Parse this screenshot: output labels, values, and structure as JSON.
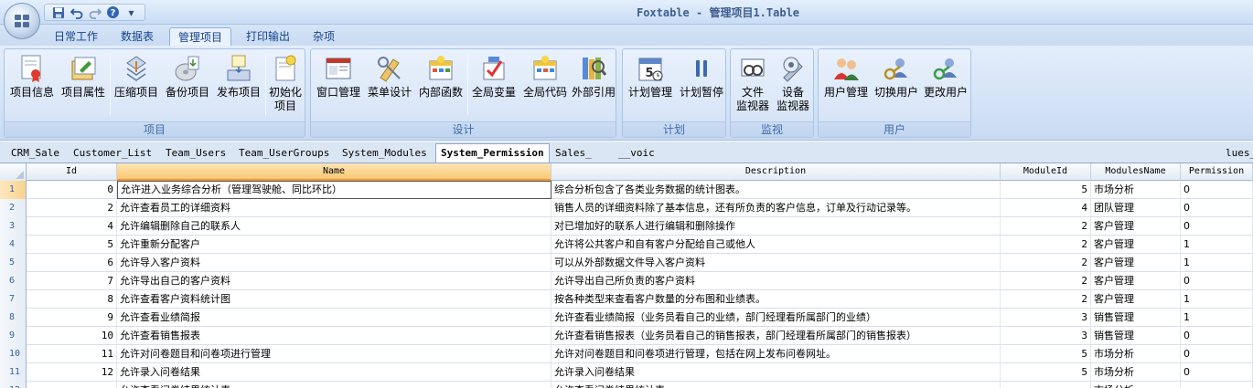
{
  "window": {
    "title": "Foxtable - 管理项目1.Table"
  },
  "qat": {
    "save_icon": "save-icon",
    "undo_icon": "undo-icon",
    "redo_icon": "redo-icon",
    "help_icon": "help-icon",
    "more": "▾"
  },
  "ribbon_tabs": [
    "日常工作",
    "数据表",
    "管理项目",
    "打印输出",
    "杂项"
  ],
  "active_ribbon_tab": "管理项目",
  "groups": {
    "project": {
      "label": "项目",
      "buttons": [
        "项目信息",
        "项目属性",
        "压缩项目",
        "备份项目",
        "发布项目",
        "初始化\n项目"
      ]
    },
    "design": {
      "label": "设计",
      "buttons": [
        "窗口管理",
        "菜单设计",
        "内部函数",
        "全局变量",
        "全局代码",
        "外部引用"
      ]
    },
    "plan": {
      "label": "计划",
      "buttons": [
        "计划管理",
        "计划暂停"
      ]
    },
    "monitor": {
      "label": "监视",
      "buttons": [
        "文件\n监视器",
        "设备\n监视器"
      ]
    },
    "user": {
      "label": "用户",
      "buttons": [
        "用户管理",
        "切换用户",
        "更改用户"
      ]
    }
  },
  "sheet_tabs": [
    "CRM_Sale",
    "Customer_List",
    "Team_Users",
    "Team_UserGroups",
    "System_Modules",
    "System_Permission",
    "Sales_",
    "__voic",
    "lues_"
  ],
  "active_sheet_tab": "System_Permission",
  "table": {
    "columns": [
      "Id",
      "Name",
      "Description",
      "ModuleId",
      "ModulesName",
      "Permission"
    ],
    "rows": [
      [
        "1",
        "0",
        "允许进入业务综合分析（管理驾驶舱、同比环比）",
        "综合分析包含了各类业务数据的统计图表。",
        "5",
        "市场分析",
        "0"
      ],
      [
        "2",
        "2",
        "允许查看员工的详细资料",
        "销售人员的详细资料除了基本信息，还有所负责的客户信息，订单及行动记录等。",
        "4",
        "团队管理",
        "0"
      ],
      [
        "3",
        "4",
        "允许编辑删除自己的联系人",
        "对已增加好的联系人进行编辑和删除操作",
        "2",
        "客户管理",
        "0"
      ],
      [
        "4",
        "5",
        "允许重新分配客户",
        "允许将公共客户和自有客户分配给自己或他人",
        "2",
        "客户管理",
        "1"
      ],
      [
        "5",
        "6",
        "允许导入客户资料",
        "可以从外部数据文件导入客户资料",
        "2",
        "客户管理",
        "1"
      ],
      [
        "6",
        "7",
        "允许导出自己的客户资料",
        "允许导出自己所负责的客户资料",
        "2",
        "客户管理",
        "0"
      ],
      [
        "7",
        "8",
        "允许查看客户资料统计图",
        "按各种类型来查看客户数量的分布图和业绩表。",
        "2",
        "客户管理",
        "1"
      ],
      [
        "8",
        "9",
        "允许查看业绩简报",
        "允许查看业绩简报（业务员看自己的业绩，部门经理看所属部门的业绩）",
        "3",
        "销售管理",
        "1"
      ],
      [
        "9",
        "10",
        "允许查看销售报表",
        "允许查看销售报表（业务员看自己的销售报表，部门经理看所属部门的销售报表）",
        "3",
        "销售管理",
        "0"
      ],
      [
        "10",
        "11",
        "允许对问卷题目和问卷项进行管理",
        "允许对问卷题目和问卷项进行管理，包括在网上发布问卷网址。",
        "5",
        "市场分析",
        "0"
      ],
      [
        "11",
        "12",
        "允许录入问卷结果",
        "允许录入问卷结果",
        "5",
        "市场分析",
        "0"
      ],
      [
        "12",
        "",
        "允许查看问卷结果统计表",
        "允许查看问卷结果统计表",
        "",
        "市场分析",
        ""
      ]
    ]
  }
}
